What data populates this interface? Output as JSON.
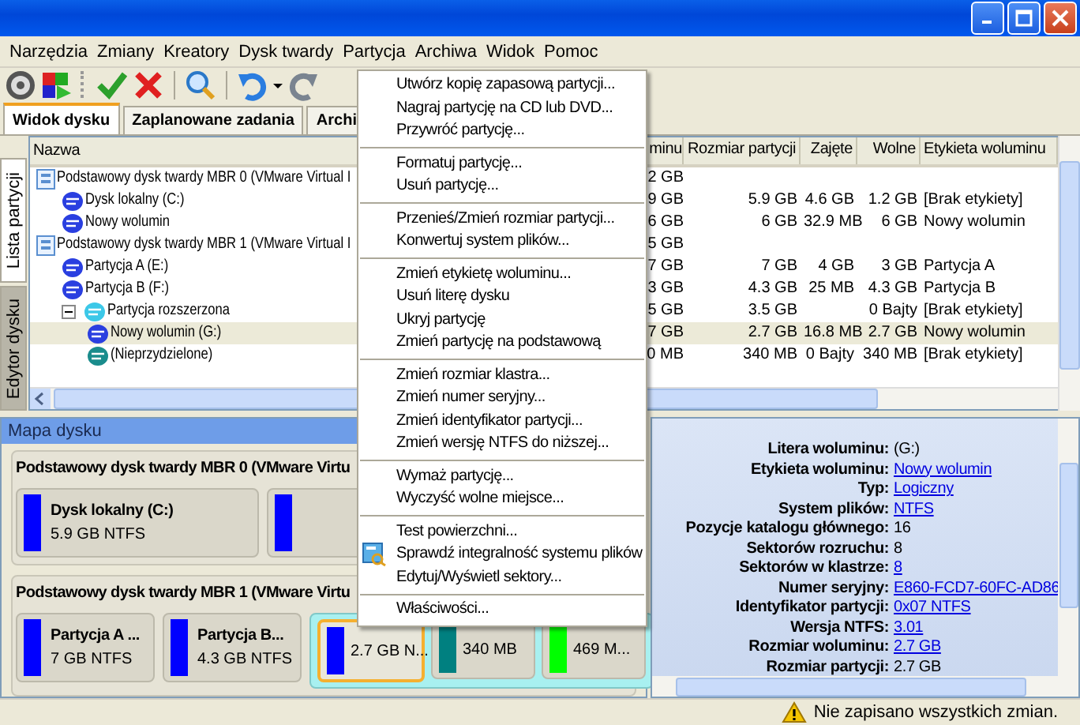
{
  "menu_bar": [
    "Narzędzia",
    "Zmiany",
    "Kreatory",
    "Dysk twardy",
    "Partycja",
    "Archiwa",
    "Widok",
    "Pomoc"
  ],
  "tabs": [
    {
      "label": "Widok dysku",
      "selected": true
    },
    {
      "label": "Zaplanowane zadania",
      "selected": false
    },
    {
      "label": "Archi",
      "selected": false
    }
  ],
  "side_tabs": [
    {
      "label": "Lista partycji",
      "selected": true
    },
    {
      "label": "Edytor dysku",
      "selected": false
    }
  ],
  "table": {
    "columns": [
      "Nazwa",
      "minu",
      "Rozmiar partycji",
      "Zajęte",
      "Wolne",
      "Etykieta woluminu"
    ],
    "rows": [
      {
        "kind": "disk",
        "name": "Podstawowy dysk twardy MBR 0 (VMware Virtual I",
        "cells": [
          "2 GB",
          null,
          null,
          null,
          null
        ],
        "selected": false,
        "children": [
          {
            "kind": "partition",
            "name": "Dysk lokalny (C:)",
            "color": "#2a3fe0",
            "cells": [
              "9 GB",
              "5.9 GB",
              "4.6 GB",
              "1.2 GB",
              "[Brak etykiety]"
            ],
            "selected": false
          },
          {
            "kind": "partition",
            "name": "Nowy wolumin",
            "color": "#2a3fe0",
            "cells": [
              "6 GB",
              "6 GB",
              "32.9 MB",
              "6 GB",
              "Nowy wolumin"
            ],
            "selected": false
          }
        ]
      },
      {
        "kind": "disk",
        "name": "Podstawowy dysk twardy MBR 1 (VMware Virtual I",
        "cells": [
          "5 GB",
          null,
          null,
          null,
          null
        ],
        "selected": false,
        "children": [
          {
            "kind": "partition",
            "name": "Partycja A (E:)",
            "color": "#2a3fe0",
            "cells": [
              "7 GB",
              "7 GB",
              "4 GB",
              "3 GB",
              "Partycja A"
            ],
            "selected": false
          },
          {
            "kind": "partition",
            "name": "Partycja B (F:)",
            "color": "#2a3fe0",
            "cells": [
              "3 GB",
              "4.3 GB",
              "25 MB",
              "4.3 GB",
              "Partycja B"
            ],
            "selected": false
          },
          {
            "kind": "partition",
            "name": "Partycja rozszerzona",
            "color": "#3cc8e8",
            "expanded": true,
            "cells": [
              "5 GB",
              "3.5 GB",
              null,
              "0 Bajty",
              "[Brak etykiety]"
            ],
            "selected": false,
            "children": [
              {
                "kind": "partition",
                "name": "Nowy wolumin (G:)",
                "color": "#2a3fe0",
                "cells": [
                  "7 GB",
                  "2.7 GB",
                  "16.8 MB",
                  "2.7 GB",
                  "Nowy wolumin"
                ],
                "selected": true
              },
              {
                "kind": "partition",
                "name": "(Nieprzydzielone)",
                "color": "#1a8c8c",
                "cells": [
                  "0 MB",
                  "340 MB",
                  "0 Bajty",
                  "340 MB",
                  "[Brak etykiety]"
                ],
                "selected": false
              }
            ]
          }
        ]
      }
    ]
  },
  "disk_map": {
    "title": "Mapa dysku",
    "disks": [
      {
        "title": "Podstawowy dysk twardy MBR 0 (VMware Virtu",
        "partitions": [
          {
            "kind": "partition",
            "title": "Dysk lokalny (C:)",
            "size": "5.9 GB NTFS",
            "color": "#0000ff",
            "selected": false
          },
          {
            "kind": "partition",
            "color": "#0000ff",
            "selected": false
          }
        ]
      },
      {
        "title": "Podstawowy dysk twardy MBR 1 (VMware Virtu",
        "partitions": [
          {
            "kind": "partition",
            "title": "Partycja A ...",
            "size": "7 GB NTFS",
            "color": "#0000ff",
            "selected": false
          },
          {
            "kind": "partition",
            "title": "Partycja B...",
            "size": "4.3 GB NTFS",
            "color": "#0000ff",
            "selected": false
          },
          {
            "kind": "extended",
            "children": [
              {
                "kind": "partition",
                "size": "2.7 GB N...",
                "color": "#0000ff",
                "selected": true
              },
              {
                "kind": "partition",
                "size": "340 MB",
                "color": "#008080",
                "selected": false
              },
              {
                "kind": "partition",
                "size": "469 M...",
                "color": "#00ff00",
                "selected": false
              }
            ]
          }
        ]
      }
    ]
  },
  "properties": [
    {
      "label": "Litera woluminu:",
      "value": "(G:)",
      "link": false
    },
    {
      "label": "Etykieta woluminu:",
      "value": "Nowy wolumin",
      "link": true
    },
    {
      "label": "Typ:",
      "value": "Logiczny",
      "link": true
    },
    {
      "label": "System plików:",
      "value": "NTFS",
      "link": true
    },
    {
      "label": "Pozycje katalogu głównego:",
      "value": "16",
      "link": false
    },
    {
      "label": "Sektorów rozruchu:",
      "value": "8",
      "link": false
    },
    {
      "label": "Sektorów w klastrze:",
      "value": "8",
      "link": true
    },
    {
      "label": "Numer seryjny:",
      "value": "E860-FCD7-60FC-AD86",
      "link": true
    },
    {
      "label": "Identyfikator partycji:",
      "value": "0x07 NTFS",
      "link": true
    },
    {
      "label": "Wersja NTFS:",
      "value": "3.01",
      "link": true
    },
    {
      "label": "Rozmiar woluminu:",
      "value": "2.7 GB",
      "link": true
    },
    {
      "label": "Rozmiar partycji:",
      "value": "2.7 GB",
      "link": false
    }
  ],
  "context_menu": [
    [
      {
        "label": "Utwórz kopię zapasową partycji...",
        "kind": "plain"
      },
      {
        "label": "Nagraj partycję na CD lub DVD...",
        "kind": "plain"
      },
      {
        "label": "Przywróć partycję...",
        "kind": "plain"
      }
    ],
    [
      {
        "label": "Formatuj partycję...",
        "kind": "plain"
      },
      {
        "label": "Usuń partycję...",
        "kind": "plain"
      }
    ],
    [
      {
        "label": "Przenieś/Zmień rozmiar partycji...",
        "kind": "plain"
      },
      {
        "label": "Konwertuj system plików...",
        "kind": "plain"
      }
    ],
    [
      {
        "label": "Zmień etykietę woluminu...",
        "kind": "plain"
      },
      {
        "label": "Usuń literę dysku",
        "kind": "plain"
      },
      {
        "label": "Ukryj partycję",
        "kind": "plain"
      },
      {
        "label": "Zmień partycję na podstawową",
        "kind": "plain"
      }
    ],
    [
      {
        "label": "Zmień rozmiar klastra...",
        "kind": "plain"
      },
      {
        "label": "Zmień numer seryjny...",
        "kind": "plain"
      },
      {
        "label": "Zmień identyfikator partycji...",
        "kind": "plain"
      },
      {
        "label": "Zmień wersję NTFS do niższej...",
        "kind": "plain"
      }
    ],
    [
      {
        "label": "Wymaż partycję...",
        "kind": "plain"
      },
      {
        "label": "Wyczyść wolne miejsce...",
        "kind": "plain"
      }
    ],
    [
      {
        "label": "Test powierzchni...",
        "kind": "plain"
      },
      {
        "label": "Sprawdź integralność systemu plików",
        "kind": "icon"
      },
      {
        "label": "Edytuj/Wyświetl sektory...",
        "kind": "plain"
      }
    ],
    [
      {
        "label": "Właściwości...",
        "kind": "plain"
      }
    ]
  ],
  "status_bar": {
    "message": "Nie zapisano wszystkich zmian."
  }
}
